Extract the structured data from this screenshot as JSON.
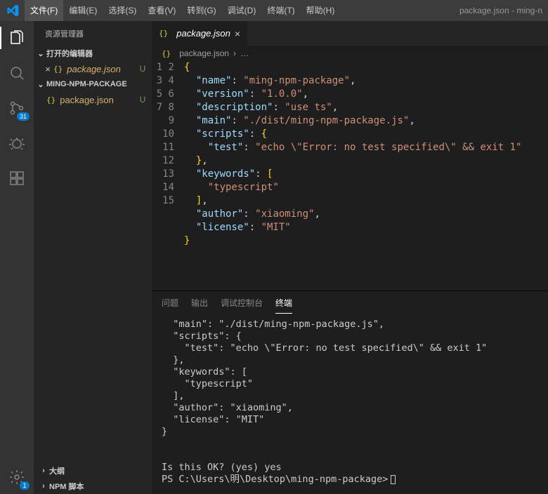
{
  "title": "package.json - ming-n",
  "menu": [
    "文件(F)",
    "编辑(E)",
    "选择(S)",
    "查看(V)",
    "转到(G)",
    "调试(D)",
    "终端(T)",
    "帮助(H)"
  ],
  "activity_badge_scm": "31",
  "activity_badge_settings": "1",
  "sidebar": {
    "title": "资源管理器",
    "openEditors": "打开的编辑器",
    "project": "MING-NPM-PACKAGE",
    "openFile": "package.json",
    "openFileStatus": "U",
    "projectFile": "package.json",
    "projectFileStatus": "U",
    "outline": "大纲",
    "npmScripts": "NPM 脚本"
  },
  "tab": {
    "name": "package.json"
  },
  "breadcrumb_file": "package.json",
  "editorLines": {
    "l1": "{",
    "l2k": "\"name\"",
    "l2v": "\"ming-npm-package\"",
    "l3k": "\"version\"",
    "l3v": "\"1.0.0\"",
    "l4k": "\"description\"",
    "l4v": "\"use ts\"",
    "l5k": "\"main\"",
    "l5v": "\"./dist/ming-npm-package.js\"",
    "l6k": "\"scripts\"",
    "l7k": "\"test\"",
    "l7v": "\"echo \\\"Error: no test specified\\\" && exit 1\"",
    "l9k": "\"keywords\"",
    "l10v": "\"typescript\"",
    "l12k": "\"author\"",
    "l12v": "\"xiaoming\"",
    "l13k": "\"license\"",
    "l13v": "\"MIT\""
  },
  "panelTabs": {
    "problems": "问题",
    "output": "输出",
    "debug": "调试控制台",
    "terminal": "终端"
  },
  "terminalText": "  \"main\": \"./dist/ming-npm-package.js\",\n  \"scripts\": {\n    \"test\": \"echo \\\"Error: no test specified\\\" && exit 1\"\n  },\n  \"keywords\": [\n    \"typescript\"\n  ],\n  \"author\": \"xiaoming\",\n  \"license\": \"MIT\"\n}\n\n\nIs this OK? (yes) yes",
  "prompt": "PS C:\\Users\\明\\Desktop\\ming-npm-package>"
}
